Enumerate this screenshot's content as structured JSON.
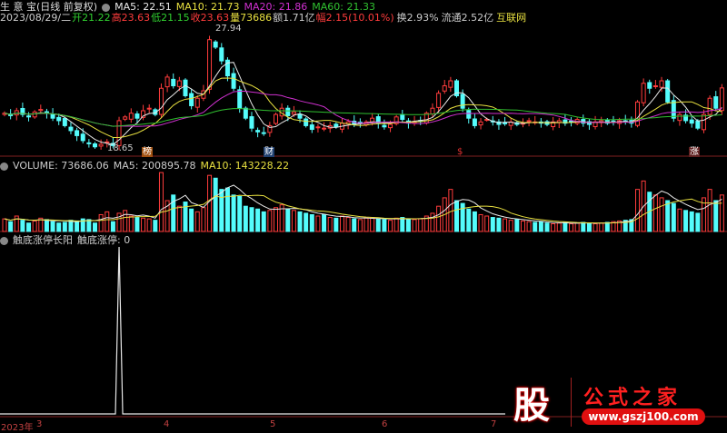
{
  "header": {
    "title": "生 意 宝(日线 前复权)",
    "ma5": "MA5: 22.51",
    "ma10": "MA10: 21.73",
    "ma20": "MA20: 21.86",
    "ma60": "MA60: 21.33",
    "date": "2023/08/29/二",
    "open": "开21.22",
    "high": "高23.63",
    "low": "低21.15",
    "close": "收23.63",
    "volume": "量73686",
    "amount": "额1.71亿",
    "change": "幅2.15(10.01%)",
    "turnover": "换2.93%",
    "float": "流通2.52亿",
    "sector": "互联网"
  },
  "volume_header": {
    "label": "VOLUME: 73686.06",
    "ma5": "MA5: 200895.78",
    "ma10": "MA10: 143228.22"
  },
  "indicator_header": {
    "label": "触底涨停长阳",
    "value": "触底涨停: 0"
  },
  "markers": {
    "high": "27.94",
    "low": "18.65",
    "m1": "榜",
    "m2": "财",
    "m3": "$",
    "m4": "涨"
  },
  "axis": {
    "year": "2023年",
    "months": [
      "3",
      "4",
      "5",
      "6",
      "7"
    ]
  },
  "logo": {
    "char": "股",
    "name": "公式之家",
    "url": "www.gszj100.com"
  },
  "colors": {
    "up": "#ff3c3c",
    "down": "#54fcfc",
    "ma5": "#e8e8e8",
    "ma10": "#e8e040",
    "ma20": "#d030d0",
    "ma60": "#30c030"
  },
  "chart_data": {
    "type": "candlestick",
    "price_range": [
      18.3,
      28.5
    ],
    "close": [
      21.6,
      21.4,
      21.8,
      21.5,
      21.3,
      21.7,
      21.9,
      21.6,
      21.2,
      21.0,
      20.6,
      20.2,
      19.8,
      19.4,
      19.2,
      18.9,
      19.1,
      19.3,
      19.0,
      21.0,
      21.3,
      21.6,
      21.2,
      21.8,
      22.0,
      21.5,
      23.6,
      24.5,
      23.8,
      24.2,
      23.0,
      22.2,
      22.8,
      23.4,
      27.5,
      26.9,
      25.8,
      24.6,
      23.6,
      22.0,
      21.2,
      20.4,
      20.1,
      20.0,
      20.6,
      21.5,
      22.0,
      21.4,
      21.7,
      21.2,
      20.6,
      20.3,
      20.5,
      20.4,
      20.6,
      20.5,
      20.8,
      20.9,
      20.7,
      20.8,
      20.9,
      21.2,
      20.8,
      20.5,
      20.7,
      21.3,
      21.1,
      20.8,
      20.9,
      21.0,
      21.6,
      22.0,
      23.2,
      23.8,
      24.2,
      23.0,
      22.0,
      21.2,
      20.6,
      20.9,
      21.1,
      20.9,
      20.7,
      20.8,
      20.9,
      20.7,
      20.8,
      21.0,
      20.9,
      20.8,
      20.7,
      20.9,
      21.0,
      20.8,
      20.9,
      21.1,
      20.8,
      20.7,
      20.9,
      21.0,
      20.8,
      20.9,
      21.0,
      20.9,
      20.8,
      22.5,
      24.0,
      23.6,
      23.8,
      24.2,
      22.5,
      21.2,
      21.5,
      21.0,
      20.8,
      20.4,
      21.5,
      22.8,
      22.0,
      23.63
    ],
    "volume": [
      90,
      70,
      110,
      80,
      60,
      75,
      95,
      85,
      70,
      60,
      65,
      80,
      75,
      90,
      85,
      60,
      120,
      140,
      70,
      130,
      150,
      110,
      100,
      95,
      90,
      80,
      420,
      220,
      260,
      180,
      210,
      160,
      140,
      170,
      400,
      380,
      300,
      310,
      260,
      250,
      180,
      170,
      160,
      140,
      150,
      170,
      190,
      160,
      150,
      140,
      130,
      120,
      110,
      120,
      100,
      95,
      110,
      100,
      90,
      85,
      95,
      100,
      90,
      85,
      80,
      95,
      100,
      90,
      85,
      90,
      110,
      130,
      180,
      240,
      300,
      220,
      200,
      160,
      140,
      120,
      110,
      100,
      95,
      90,
      80,
      85,
      75,
      70,
      65,
      70,
      60,
      55,
      60,
      65,
      55,
      60,
      65,
      60,
      55,
      60,
      65,
      70,
      75,
      80,
      85,
      300,
      360,
      280,
      260,
      240,
      220,
      200,
      160,
      150,
      140,
      130,
      240,
      300,
      220,
      260
    ],
    "volume_range": [
      0,
      440
    ],
    "indicator": {
      "name": "触底涨停",
      "spike_index": 19,
      "values_note": "0 except 1 at spike"
    }
  }
}
